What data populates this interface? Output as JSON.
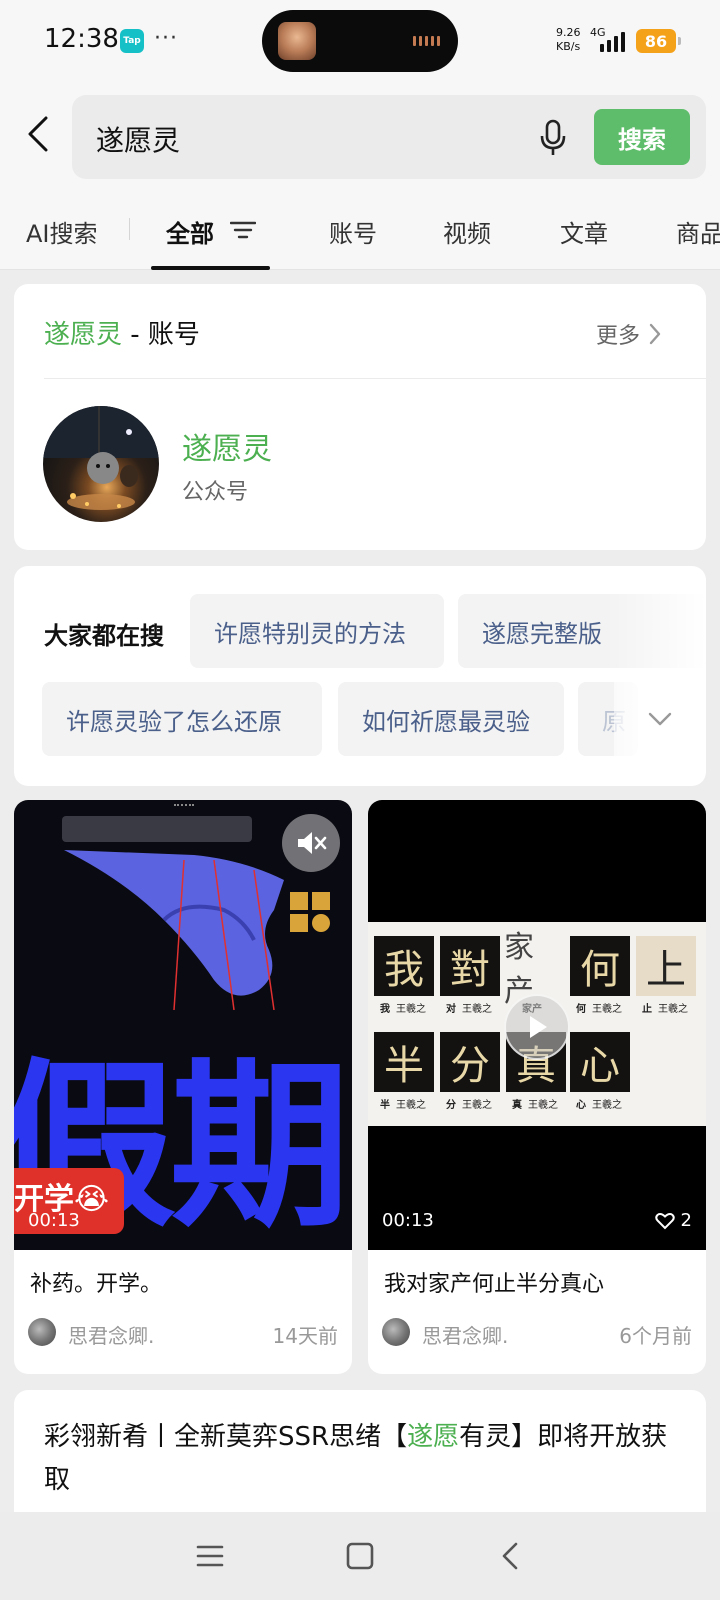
{
  "status_bar": {
    "time": "12:38",
    "app_badge": "Tap",
    "more_dots": "···",
    "net_speed_value": "9.26",
    "net_speed_unit": "KB/s",
    "net_type": "4G",
    "battery": "86",
    "battery_color": "#f5a21b"
  },
  "search": {
    "query": "遂愿灵",
    "button_label": "搜索",
    "accent": "#5ebd6a"
  },
  "tabs": [
    {
      "label": "AI搜索"
    },
    {
      "label": "全部",
      "active": true
    },
    {
      "label": "账号"
    },
    {
      "label": "视频"
    },
    {
      "label": "文章"
    },
    {
      "label": "商品"
    }
  ],
  "account_section": {
    "title_keyword": "遂愿灵",
    "title_suffix": " - 账号",
    "more_label": "更多",
    "account_name": "遂愿灵",
    "account_type": "公众号",
    "highlight_color": "#4caf50"
  },
  "trending": {
    "label": "大家都在搜",
    "chips": [
      "许愿特别灵的方法",
      "遂愿完整版",
      "许愿灵验了怎么还原",
      "如何祈愿最灵验",
      "原"
    ]
  },
  "videos": [
    {
      "title": "补药。开学。",
      "duration": "00:13",
      "overlay_text": "开学😭",
      "thumb_text": "假期",
      "author": "思君念卿.",
      "time_ago": "14天前"
    },
    {
      "title": "我对家产何止半分真心",
      "duration": "00:13",
      "likes": "2",
      "author": "思君念卿.",
      "time_ago": "6个月前",
      "glyphs_row1": [
        {
          "char": "我",
          "caption": "我",
          "sub": "王羲之"
        },
        {
          "char": "對",
          "caption": "对",
          "sub": "王羲之"
        },
        {
          "char": "家产",
          "caption": "家产",
          "sub": ""
        },
        {
          "char": "何",
          "caption": "何",
          "sub": "王羲之"
        },
        {
          "char": "上",
          "caption": "止",
          "sub": "王羲之"
        }
      ],
      "glyphs_row2": [
        {
          "char": "半",
          "caption": "半",
          "sub": "王羲之"
        },
        {
          "char": "分",
          "caption": "分",
          "sub": "王羲之"
        },
        {
          "char": "真",
          "caption": "真",
          "sub": "王羲之"
        },
        {
          "char": "心",
          "caption": "心",
          "sub": "王羲之"
        }
      ]
    }
  ],
  "article": {
    "title_prefix": "彩翎新肴丨全新莫弈SSR思绪【",
    "title_keyword": "遂愿",
    "title_suffix": "有灵】即将开放获取"
  }
}
